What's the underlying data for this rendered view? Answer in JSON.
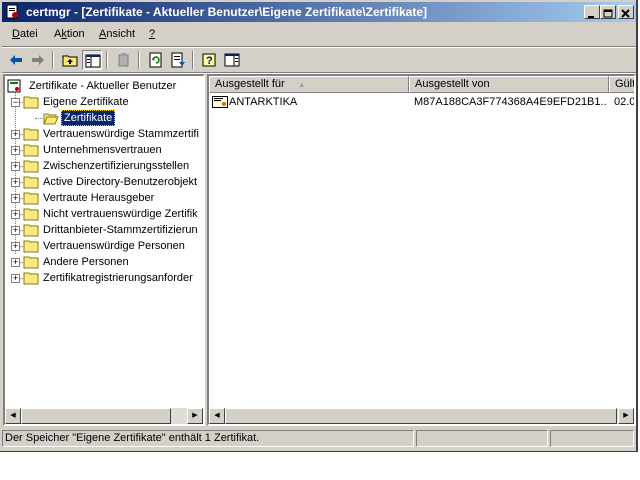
{
  "window": {
    "title": "certmgr - [Zertifikate - Aktueller Benutzer\\Eigene Zertifikate\\Zertifikate]",
    "controls": {
      "minimize": "_",
      "maximize": "□",
      "close": "×"
    }
  },
  "menu": [
    {
      "label": "Datei",
      "hotkey_index": 0
    },
    {
      "label": "Aktion",
      "hotkey_index": 1
    },
    {
      "label": "Ansicht",
      "hotkey_index": 0
    },
    {
      "label": "?",
      "hotkey_index": 0
    }
  ],
  "toolbar": {
    "icons": [
      "back-arrow-icon",
      "forward-arrow-icon",
      "up-one-level-icon",
      "show-hide-console-tree-icon",
      "delete-icon",
      "refresh-icon",
      "export-list-icon",
      "help-icon",
      "show-hide-action-pane-icon"
    ]
  },
  "tree": {
    "root": "Zertifikate - Aktueller Benutzer",
    "items": [
      {
        "label": "Eigene Zertifikate",
        "expander": "−"
      },
      {
        "label": "Zertifikate",
        "selected": true
      },
      {
        "label": "Vertrauenswürdige Stammzertifi",
        "expander": "+"
      },
      {
        "label": "Unternehmensvertrauen",
        "expander": "+"
      },
      {
        "label": "Zwischenzertifizierungsstellen",
        "expander": "+"
      },
      {
        "label": "Active Directory-Benutzerobjekt",
        "expander": "+"
      },
      {
        "label": "Vertraute Herausgeber",
        "expander": "+"
      },
      {
        "label": "Nicht vertrauenswürdige Zertifik",
        "expander": "+"
      },
      {
        "label": "Drittanbieter-Stammzertifizierun",
        "expander": "+"
      },
      {
        "label": "Vertrauenswürdige Personen",
        "expander": "+"
      },
      {
        "label": "Andere Personen",
        "expander": "+"
      },
      {
        "label": "Zertifikatregistrierungsanforder",
        "expander": "+"
      }
    ]
  },
  "list": {
    "columns": [
      "Ausgestellt für",
      "Ausgestellt von",
      "Gült"
    ],
    "sort_indicator": "▲",
    "rows": [
      {
        "issued_to": "ANTARKTIKA",
        "issued_by": "M87A188CA3F774368A4E9EFD21B1...",
        "valid": "02.0"
      }
    ]
  },
  "scroll": {
    "left": "◀",
    "right": "▶"
  },
  "status": {
    "text": "Der Speicher \"Eigene Zertifikate\" enthält 1 Zertifikat."
  },
  "colors": {
    "title_start": "#0a246a",
    "title_end": "#a6caf0",
    "face": "#d4d0c8",
    "selection": "#0a246a"
  }
}
